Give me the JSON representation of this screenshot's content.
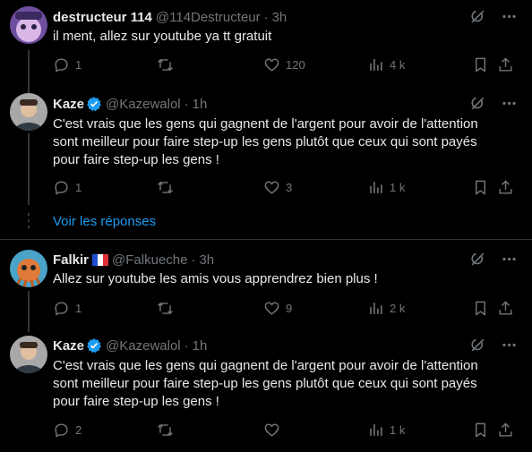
{
  "colors": {
    "background": "#000000",
    "text": "#e7e9ea",
    "muted": "#71767b",
    "accent": "#1d9bf0",
    "divider": "#2f3336"
  },
  "icons": [
    "grok-icon",
    "more-icon",
    "reply-icon",
    "retweet-icon",
    "like-icon",
    "views-icon",
    "bookmark-icon",
    "share-icon",
    "verified-icon",
    "france-flag-icon"
  ],
  "posts": [
    {
      "name": "destructeur 114",
      "handle": "@114Destructeur",
      "separator": "·",
      "time": "3h",
      "text": "il ment, allez sur youtube ya tt gratuit",
      "replies": "1",
      "retweets": "",
      "likes": "120",
      "views": "4 k"
    },
    {
      "name": "Kaze",
      "handle": "@Kazewalol",
      "separator": "·",
      "time": "1h",
      "text": "C'est vrais que les gens qui gagnent de l'argent pour avoir de l'attention sont meilleur pour faire step-up les gens plutôt que ceux qui sont payés pour faire step-up les gens !",
      "replies": "1",
      "retweets": "",
      "likes": "3",
      "views": "1 k"
    },
    {
      "name": "Falkir",
      "handle": "@Falkueche",
      "separator": "·",
      "time": "3h",
      "text": "Allez sur youtube les amis vous apprendrez bien plus !",
      "replies": "1",
      "retweets": "",
      "likes": "9",
      "views": "2 k"
    },
    {
      "name": "Kaze",
      "handle": "@Kazewalol",
      "separator": "·",
      "time": "1h",
      "text": "C'est vrais que les gens qui gagnent de l'argent pour avoir de l'attention sont meilleur pour faire step-up les gens plutôt que ceux qui sont payés pour faire step-up les gens !",
      "replies": "2",
      "retweets": "",
      "likes": "",
      "views": "1 k"
    }
  ],
  "show_replies_label": "Voir les réponses"
}
